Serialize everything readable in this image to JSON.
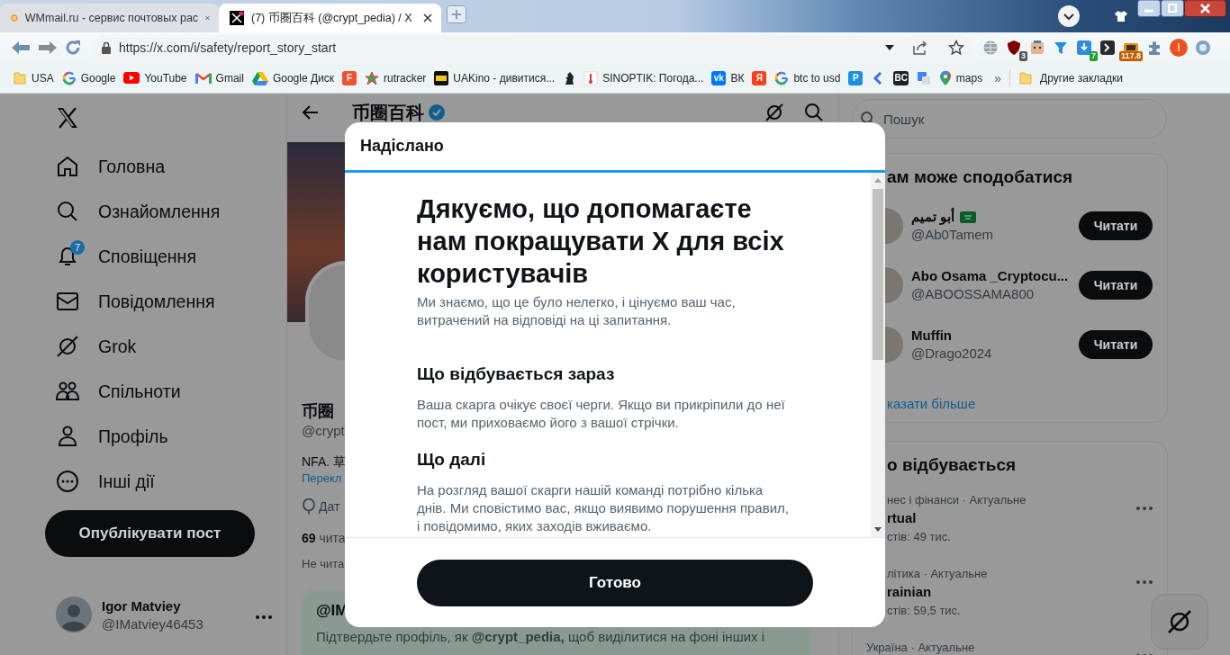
{
  "browser": {
    "tabs": [
      {
        "kind": "mail",
        "title": "WMmail.ru - сервис почтовых рас",
        "selected": false
      },
      {
        "kind": "x",
        "title": "(7) 币圈百科 (@crypt_pedia) / X",
        "selected": true
      }
    ],
    "url": "https://x.com/i/safety/report_story_start",
    "extensions": [
      {
        "kind": "globe"
      },
      {
        "kind": "shield",
        "badge": "3"
      },
      {
        "kind": "face"
      },
      {
        "kind": "funnel"
      },
      {
        "kind": "download",
        "badge": "7"
      },
      {
        "kind": "terminal"
      },
      {
        "kind": "monitor",
        "badge": "117.8"
      },
      {
        "kind": "puzzle"
      },
      {
        "kind": "account",
        "letter": "I"
      },
      {
        "kind": "orb"
      }
    ],
    "bookmarks": [
      {
        "kind": "folder",
        "label": "USA"
      },
      {
        "kind": "google",
        "label": "Google"
      },
      {
        "kind": "youtube",
        "label": "YouTube"
      },
      {
        "kind": "gmail",
        "label": "Gmail"
      },
      {
        "kind": "drive",
        "label": "Google Диск"
      },
      {
        "kind": "letter",
        "glyph": "F",
        "color": "#f0522d"
      },
      {
        "kind": "star",
        "label": "rutracker"
      },
      {
        "kind": "film",
        "label": "UAKino - дивитися..."
      },
      {
        "kind": "chess"
      },
      {
        "kind": "thermometer",
        "label": "SINOPTIK: Погода..."
      },
      {
        "kind": "letter",
        "glyph": "vk",
        "color": "#0077ff",
        "label": "ВК"
      },
      {
        "kind": "letter",
        "glyph": "Я",
        "color": "#fc3f1d"
      },
      {
        "kind": "google",
        "label": "btc to usd"
      },
      {
        "kind": "letter",
        "glyph": "P",
        "color": "#1a8fe3"
      },
      {
        "kind": "chevron"
      },
      {
        "kind": "letter",
        "glyph": "BC",
        "color": "#222222"
      },
      {
        "kind": "translate"
      },
      {
        "kind": "maps",
        "label": "maps"
      }
    ],
    "overflow": "»",
    "other_bookmarks": "Другие закладки"
  },
  "sidebar": {
    "nav": [
      {
        "kind": "home",
        "label": "Головна"
      },
      {
        "kind": "search",
        "label": "Ознайомлення"
      },
      {
        "kind": "bell",
        "label": "Сповіщення",
        "badge": "7"
      },
      {
        "kind": "mail",
        "label": "Повідомлення"
      },
      {
        "kind": "grok",
        "label": "Grok"
      },
      {
        "kind": "people",
        "label": "Спільноти"
      },
      {
        "kind": "person",
        "label": "Профіль"
      },
      {
        "kind": "more",
        "label": "Інші дії"
      }
    ],
    "post_button": "Опублікувати пост",
    "account": {
      "name": "Igor Matviey",
      "handle": "@IMatviey46453"
    }
  },
  "profile": {
    "header_title": "币圈百科",
    "verified": true,
    "name": "币圈",
    "handle": "@crypt",
    "bio": "NFA. 草",
    "translate_link": "Перекл",
    "location": "Дат",
    "followers_count": "69",
    "followers_label": "чита",
    "not_followed": "Не чита",
    "verify_card": {
      "title": "@IM",
      "text": "Підтвердьте профіль, як **@crypt_pedia,** щоб виділитися на фоні інших і"
    }
  },
  "modal": {
    "title": "Надіслано",
    "heading": "Дякуємо, що допомагаєте нам покращувати X для всіх користувачів",
    "intro": "Ми знаємо, що це було нелегко, і цінуємо ваш час, витрачений на відповіді на ці запитання.",
    "sections": [
      {
        "heading": "Що відбувається зараз",
        "text": "Ваша скарга очікує своєї черги. Якщо ви прикріпили до неї пост, ми приховаємо його з вашої стрічки."
      },
      {
        "heading": "Що далі",
        "text": "На розгляд вашої скарги нашій команді потрібно кілька днів. Ми сповістимо вас, якщо виявимо порушення правил, і повідомимо, яких заходів вживаємо."
      }
    ],
    "done_button": "Готово"
  },
  "right": {
    "search": {
      "placeholder": "Пошук"
    },
    "suggestions": {
      "title": "ам може сподобатися",
      "accounts": [
        {
          "name": "أبو تميم",
          "flag": true,
          "handle": "@Ab0Tamem",
          "follow": "Читати"
        },
        {
          "name": "Abo Osama _Cryptocu...",
          "flag": false,
          "handle": "@ABOOSSAMA800",
          "follow": "Читати"
        },
        {
          "name": "Muffin",
          "flag": false,
          "handle": "@Drago2024",
          "follow": "Читати"
        }
      ],
      "show_more": "казати більше"
    },
    "trends": {
      "title": "о відбувається",
      "items": [
        {
          "meta": "нес і фінанси · Актуальне",
          "title": "rtual",
          "count": "стів: 49 тис.",
          "partly_hidden": true
        },
        {
          "meta": "літика · Актуальне",
          "title": "rainian",
          "count": "стів: 59,5 тис.",
          "partly_hidden": true
        },
        {
          "meta": "Україна · Актуальне",
          "partly_hidden": false
        }
      ]
    }
  }
}
